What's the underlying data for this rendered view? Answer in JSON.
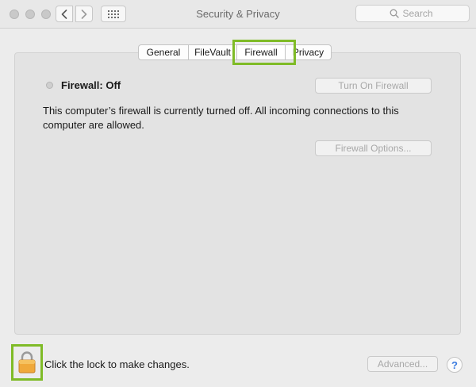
{
  "window": {
    "title": "Security & Privacy"
  },
  "toolbar": {
    "back_icon": "chevron-left-icon",
    "forward_icon": "chevron-right-icon",
    "show_all_icon": "grid-icon"
  },
  "search": {
    "placeholder": "Search",
    "icon": "search-icon"
  },
  "tabs": [
    {
      "label": "General",
      "selected": false
    },
    {
      "label": "FileVault",
      "selected": false
    },
    {
      "label": "Firewall",
      "selected": true
    },
    {
      "label": "Privacy",
      "selected": false
    }
  ],
  "firewall": {
    "status_label": "Firewall: Off",
    "turn_on_button": "Turn On Firewall",
    "description": "This computer’s firewall is currently turned off. All incoming connections to this computer are allowed.",
    "options_button": "Firewall Options..."
  },
  "footer": {
    "lock_icon": "lock-icon",
    "lock_text": "Click the lock to make changes.",
    "advanced_button": "Advanced...",
    "help_label": "?"
  },
  "colors": {
    "highlight": "#7fbb27",
    "help_accent": "#3a7be0"
  }
}
